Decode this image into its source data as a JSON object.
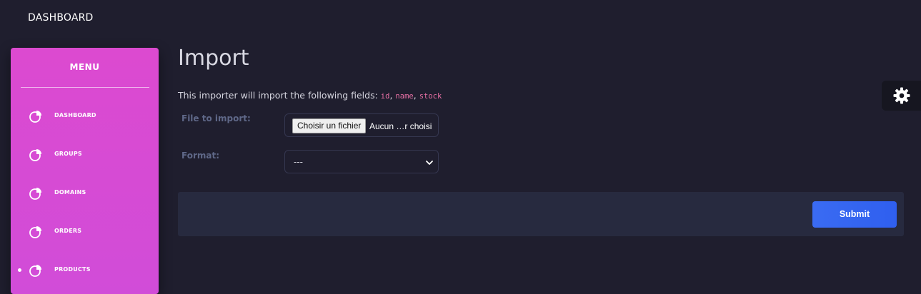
{
  "header": {
    "brand": "DASHBOARD"
  },
  "sidebar": {
    "title": "MENU",
    "active_index": 4,
    "items": [
      {
        "label": "DASHBOARD",
        "icon": "pie-chart-icon"
      },
      {
        "label": "GROUPS",
        "icon": "pie-chart-icon"
      },
      {
        "label": "DOMAINS",
        "icon": "pie-chart-icon"
      },
      {
        "label": "ORDERS",
        "icon": "pie-chart-icon"
      },
      {
        "label": "PRODUCTS",
        "icon": "pie-chart-icon"
      }
    ]
  },
  "main": {
    "title": "Import",
    "intro_text": "This importer will import the following fields:",
    "fields": [
      "id",
      "name",
      "stock"
    ],
    "form": {
      "file_label": "File to import:",
      "file_button": "Choisir un fichier",
      "file_status": "Aucun …r choisi",
      "format_label": "Format:",
      "format_value": "---"
    },
    "submit_label": "Submit"
  },
  "settings": {
    "icon": "gear-icon"
  },
  "colors": {
    "background": "#1f1e2e",
    "sidebar": "#d84bd4",
    "accent": "#3366f0",
    "code": "#e56fa3"
  }
}
